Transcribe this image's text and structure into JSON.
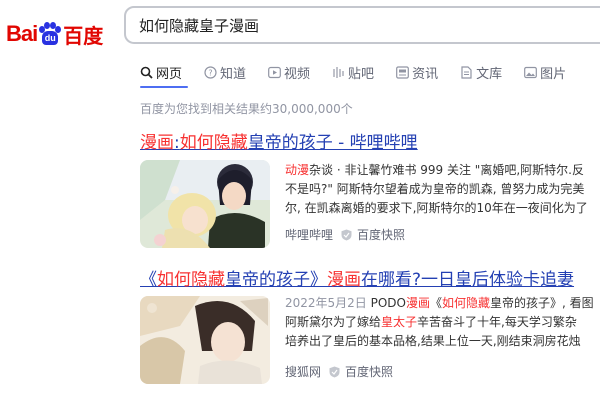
{
  "logo": {
    "latin_part": "Bai",
    "paw_text": "du",
    "chinese_part": "百度"
  },
  "search": {
    "query": "如何隐藏皇子漫画"
  },
  "tabs": [
    {
      "label": "网页",
      "icon": "search-icon",
      "active": true
    },
    {
      "label": "知道",
      "icon": "question-icon",
      "active": false
    },
    {
      "label": "视频",
      "icon": "video-icon",
      "active": false
    },
    {
      "label": "贴吧",
      "icon": "tieba-icon",
      "active": false
    },
    {
      "label": "资讯",
      "icon": "news-icon",
      "active": false
    },
    {
      "label": "文库",
      "icon": "document-icon",
      "active": false
    },
    {
      "label": "图片",
      "icon": "image-icon",
      "active": false
    }
  ],
  "result_count": "百度为您找到相关结果约30,000,000个",
  "results": [
    {
      "title": [
        {
          "t": "漫画",
          "em": true
        },
        {
          "t": ":",
          "em": false
        },
        {
          "t": "如何隐藏",
          "em": true
        },
        {
          "t": "皇帝的孩子 - 哔哩哔哩",
          "em": false
        }
      ],
      "lines": [
        [
          {
            "t": "动漫",
            "em": true
          },
          {
            "t": "杂谈 · 非让馨竹难书 999 关注 \"离婚吧,阿斯特尔.反",
            "em": false
          }
        ],
        [
          {
            "t": "不是吗?\" 阿斯特尔望着成为皇帝的凯森, 曾努力成为完美",
            "em": false
          }
        ],
        [
          {
            "t": "尔, 在凯森离婚的要求下,阿斯特尔的10年在一夜间化为了",
            "em": false
          }
        ]
      ],
      "source": "哔哩哔哩",
      "snapshot": "百度快照"
    },
    {
      "title": [
        {
          "t": "《",
          "em": false
        },
        {
          "t": "如何隐藏",
          "em": true
        },
        {
          "t": "皇帝的孩子》",
          "em": false
        },
        {
          "t": "漫画",
          "em": true
        },
        {
          "t": "在哪看?一日皇后体验卡追妻",
          "em": false
        }
      ],
      "lines": [
        [
          {
            "t": "2022年5月2日 ",
            "em": false,
            "date": true
          },
          {
            "t": "PODO",
            "em": false
          },
          {
            "t": "漫画",
            "em": true
          },
          {
            "t": "《",
            "em": false
          },
          {
            "t": "如何隐藏",
            "em": true
          },
          {
            "t": "皇帝的孩子》, 看图",
            "em": false
          }
        ],
        [
          {
            "t": "阿斯黛尔为了嫁给",
            "em": false
          },
          {
            "t": "皇太子",
            "em": true
          },
          {
            "t": "辛苦奋斗了十年,每天学习繁杂",
            "em": false
          }
        ],
        [
          {
            "t": "培养出了皇后的基本品格,结果上位一天,刚结束洞房花烛",
            "em": false
          }
        ]
      ],
      "source": "搜狐网",
      "snapshot": "百度快照"
    }
  ],
  "colors": {
    "link": "#2440b3",
    "highlight": "#f73131",
    "brand_red": "#e10601",
    "brand_blue": "#2932e1",
    "tab_accent": "#4e6ef2"
  }
}
